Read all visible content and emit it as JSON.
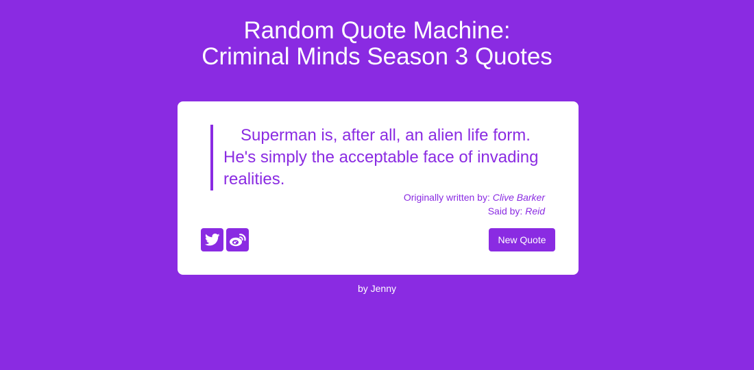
{
  "header": {
    "title_line1": "Random Quote Machine:",
    "title_line2": "Criminal Minds Season 3 Quotes"
  },
  "quote": {
    "text": "Superman is, after all, an alien life form. He's simply the acceptable face of invading realities.",
    "author_label": "Originally written by:",
    "author": "Clive Barker",
    "speaker_label": "Said by:",
    "speaker": "Reid"
  },
  "actions": {
    "twitter_icon": "twitter-icon",
    "weibo_icon": "weibo-icon",
    "new_quote_label": "New Quote"
  },
  "footer": {
    "text": "by Jenny"
  },
  "colors": {
    "accent": "#8a2be2",
    "card_background": "#ffffff",
    "text_on_accent": "#ffffff"
  }
}
